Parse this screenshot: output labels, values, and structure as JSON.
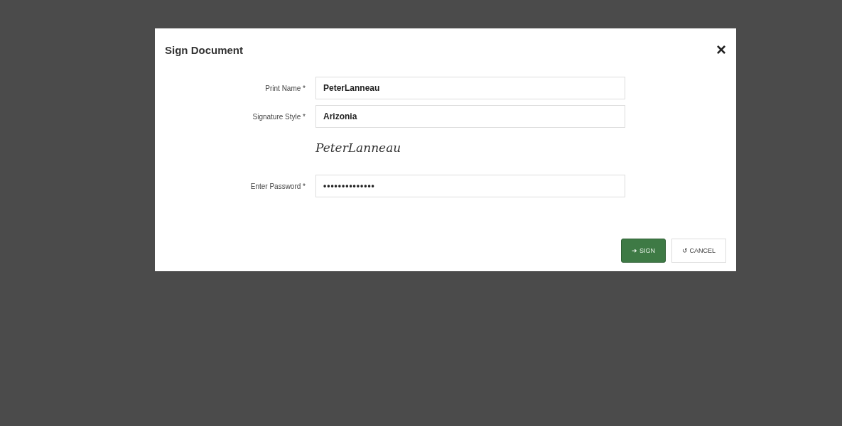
{
  "dialog": {
    "title": "Sign Document",
    "close": "×",
    "fields": [
      {
        "kind": "text",
        "label": "Print Name *",
        "value": "PeterLanneau"
      },
      {
        "kind": "text",
        "label": "Signature Style *",
        "value": "Arizonia"
      },
      {
        "kind": "preview",
        "value": "PeterLanneau"
      },
      {
        "kind": "password",
        "label": "Enter Password *",
        "value": "••••••••••••••"
      }
    ],
    "buttons": [
      {
        "kind": "primary",
        "icon": "➜",
        "label": "SIGN"
      },
      {
        "kind": "default",
        "icon": "↺",
        "label": "CANCEL"
      }
    ]
  }
}
